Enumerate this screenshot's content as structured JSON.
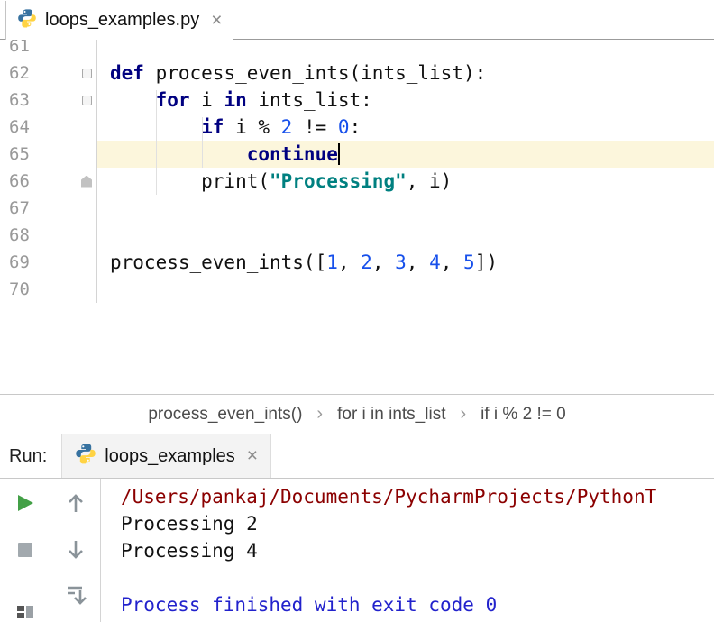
{
  "colors": {
    "keyword": "#000080",
    "number": "#1750EB",
    "string": "#008080",
    "lineHighlight": "#FCF6DC",
    "consolePath": "#8B0000",
    "consoleInfo": "#2222CC",
    "runGreen": "#43A047"
  },
  "editorTab": {
    "title": "loops_examples.py",
    "close_glyph": "×"
  },
  "editor": {
    "lines": [
      {
        "num": "61",
        "segments": []
      },
      {
        "num": "62",
        "fold": "open",
        "segments": [
          {
            "t": "def",
            "c": "kw"
          },
          {
            "t": " process_even_ints(ints_list):",
            "c": "plain"
          }
        ]
      },
      {
        "num": "63",
        "fold": "open",
        "segments": [
          {
            "t": "    ",
            "c": "plain"
          },
          {
            "t": "for",
            "c": "kw"
          },
          {
            "t": " i ",
            "c": "plain"
          },
          {
            "t": "in",
            "c": "kw"
          },
          {
            "t": " ints_list:",
            "c": "plain"
          }
        ]
      },
      {
        "num": "64",
        "segments": [
          {
            "t": "        ",
            "c": "plain"
          },
          {
            "t": "if",
            "c": "kw"
          },
          {
            "t": " i % ",
            "c": "plain"
          },
          {
            "t": "2",
            "c": "num"
          },
          {
            "t": " != ",
            "c": "plain"
          },
          {
            "t": "0",
            "c": "num"
          },
          {
            "t": ":",
            "c": "plain"
          }
        ]
      },
      {
        "num": "65",
        "highlight": true,
        "caret": true,
        "segments": [
          {
            "t": "            ",
            "c": "plain"
          },
          {
            "t": "continue",
            "c": "kw"
          }
        ]
      },
      {
        "num": "66",
        "fold": "end",
        "segments": [
          {
            "t": "        print(",
            "c": "plain"
          },
          {
            "t": "\"Processing\"",
            "c": "str"
          },
          {
            "t": ", i)",
            "c": "plain"
          }
        ]
      },
      {
        "num": "67",
        "segments": []
      },
      {
        "num": "68",
        "segments": []
      },
      {
        "num": "69",
        "segments": [
          {
            "t": "process_even_ints([",
            "c": "plain"
          },
          {
            "t": "1",
            "c": "num"
          },
          {
            "t": ", ",
            "c": "plain"
          },
          {
            "t": "2",
            "c": "num"
          },
          {
            "t": ", ",
            "c": "plain"
          },
          {
            "t": "3",
            "c": "num"
          },
          {
            "t": ", ",
            "c": "plain"
          },
          {
            "t": "4",
            "c": "num"
          },
          {
            "t": ", ",
            "c": "plain"
          },
          {
            "t": "5",
            "c": "num"
          },
          {
            "t": "])",
            "c": "plain"
          }
        ]
      },
      {
        "num": "70",
        "segments": []
      }
    ]
  },
  "breadcrumbs": {
    "separator": "›",
    "items": [
      "process_even_ints()",
      "for i in ints_list",
      "if i % 2 != 0"
    ]
  },
  "run": {
    "label": "Run:",
    "tab": "loops_examples",
    "close_glyph": "×"
  },
  "console": {
    "lines": [
      {
        "text": "/Users/pankaj/Documents/PycharmProjects/PythonT",
        "cls": "path"
      },
      {
        "text": "Processing 2",
        "cls": "plain"
      },
      {
        "text": "Processing 4",
        "cls": "plain"
      },
      {
        "text": "",
        "cls": "plain"
      },
      {
        "text": "Process finished with exit code 0",
        "cls": "info"
      }
    ]
  },
  "icons": {
    "toolbar": [
      "rerun-icon",
      "stop-icon",
      "restore-layout-icon",
      "up-arrow-icon",
      "down-arrow-icon",
      "scroll-to-end-icon"
    ]
  }
}
